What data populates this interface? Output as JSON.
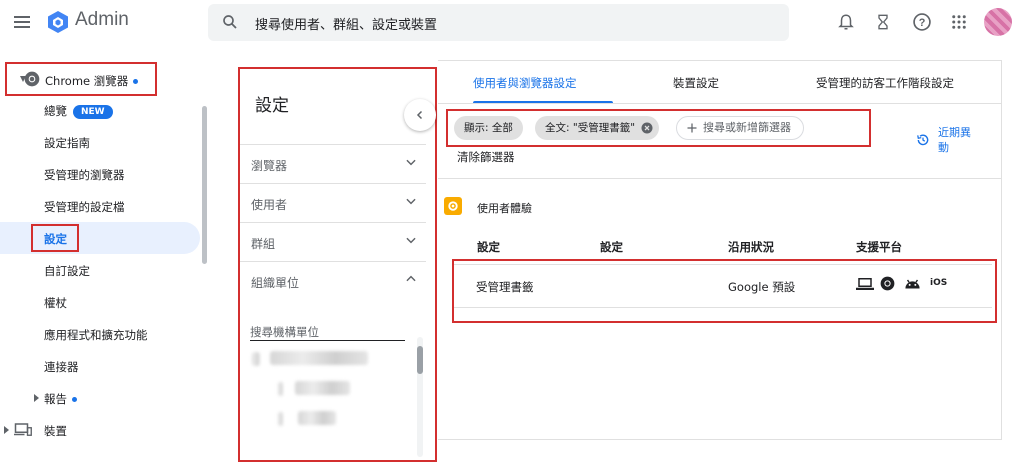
{
  "header": {
    "app_title": "Admin",
    "search_placeholder": "搜尋使用者、群組、設定或裝置"
  },
  "nav": {
    "chrome_label": "Chrome 瀏覽器",
    "items": [
      {
        "label": "總覽",
        "badge": "NEW"
      },
      {
        "label": "設定指南"
      },
      {
        "label": "受管理的瀏覽器"
      },
      {
        "label": "受管理的設定檔"
      },
      {
        "label": "設定"
      },
      {
        "label": "自訂設定"
      },
      {
        "label": "權杖"
      },
      {
        "label": "應用程式和擴充功能"
      },
      {
        "label": "連接器"
      },
      {
        "label": "報告"
      }
    ],
    "devices_label": "裝置"
  },
  "settings_panel": {
    "title": "設定",
    "sections": [
      {
        "label": "瀏覽器"
      },
      {
        "label": "使用者"
      },
      {
        "label": "群組"
      },
      {
        "label": "組織單位"
      }
    ],
    "ou_search_placeholder": "搜尋機構單位"
  },
  "main": {
    "tabs": [
      {
        "label": "使用者與瀏覽器設定",
        "active": true
      },
      {
        "label": "裝置設定"
      },
      {
        "label": "受管理的訪客工作階段設定"
      }
    ],
    "filters": {
      "chips": [
        "顯示: 全部",
        "全文: \"受管理書籤\""
      ],
      "add_label": "搜尋或新增篩選器",
      "clear_label": "清除篩選器"
    },
    "recent_label": "近期異動",
    "section_title": "使用者體驗",
    "table": {
      "headers": [
        "設定",
        "設定",
        "沿用狀況",
        "支援平台"
      ],
      "rows": [
        {
          "setting": "受管理書籤",
          "value": "",
          "inheritance": "Google 預設",
          "platforms": [
            "laptop-icon",
            "chrome-icon",
            "android-icon",
            "ios-icon"
          ]
        }
      ],
      "ios_text": "iOS"
    }
  },
  "colors": {
    "accent": "#1a73e8",
    "highlight": "#d32f2f",
    "ux_icon": "#f9ab00"
  }
}
